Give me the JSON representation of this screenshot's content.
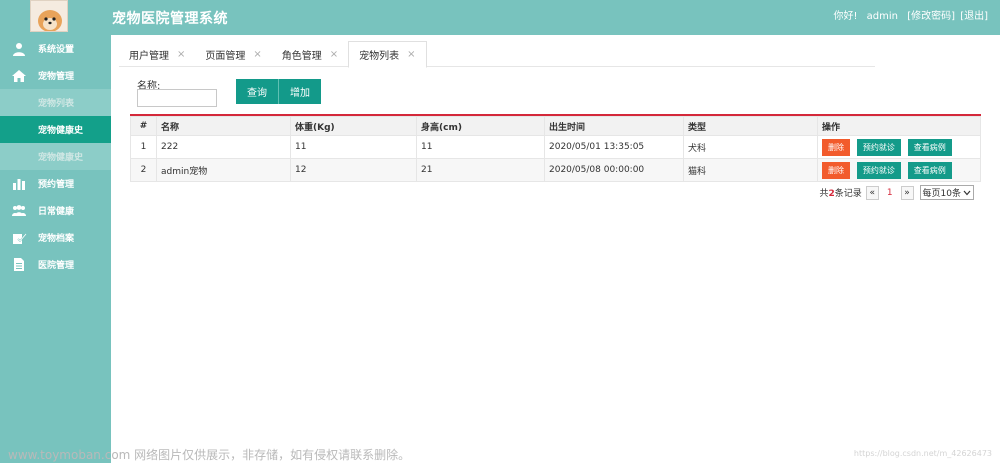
{
  "header": {
    "title": "宠物医院管理系统",
    "greeting": "你好!",
    "username": "admin",
    "change_password": "[修改密码]",
    "logout": "[退出]",
    "bg_color": "#78c3be"
  },
  "sidebar": {
    "items": [
      {
        "label": "系统设置",
        "icon": "user-icon"
      },
      {
        "label": "宠物管理",
        "icon": "home-icon"
      },
      {
        "label": "宠物列表",
        "icon": ""
      },
      {
        "label": "宠物健康史",
        "icon": ""
      },
      {
        "label": "宠物健康史",
        "icon": ""
      },
      {
        "label": "预约管理",
        "icon": "bar-chart-icon"
      },
      {
        "label": "日常健康",
        "icon": "group-icon"
      },
      {
        "label": "宠物档案",
        "icon": "edit-check-icon"
      },
      {
        "label": "医院管理",
        "icon": "document-icon"
      }
    ],
    "active_color": "#13a08a"
  },
  "tabs": [
    {
      "label": "用户管理",
      "close": "×"
    },
    {
      "label": "页面管理",
      "close": "×"
    },
    {
      "label": "角色管理",
      "close": "×"
    },
    {
      "label": "宠物列表",
      "close": "×",
      "active": true
    }
  ],
  "search": {
    "label": "名称:",
    "value": "",
    "query_button": "查询",
    "add_button": "增加"
  },
  "table": {
    "columns": [
      "#",
      "名称",
      "体重(Kg)",
      "身高(cm)",
      "出生时间",
      "类型",
      "操作"
    ],
    "rows": [
      {
        "index": "1",
        "name": "222",
        "weight": "11",
        "height": "11",
        "birth": "2020/05/01 13:35:05",
        "type": "犬科"
      },
      {
        "index": "2",
        "name": "admin宠物",
        "weight": "12",
        "height": "21",
        "birth": "2020/05/08 00:00:00",
        "type": "猫科"
      }
    ],
    "actions": {
      "delete": "删除",
      "appointment": "预约就诊",
      "view_case": "查看病例"
    },
    "accent_color": "#d4283a"
  },
  "pager": {
    "prefix": "共",
    "total": "2",
    "suffix": "条记录",
    "prev": "«",
    "current": "1",
    "next": "»",
    "page_size": "每页10条"
  },
  "watermark": {
    "left": "www.toymoban.com 网络图片仅供展示，非存储，如有侵权请联系删除。",
    "right": "https://blog.csdn.net/m_42626473"
  }
}
